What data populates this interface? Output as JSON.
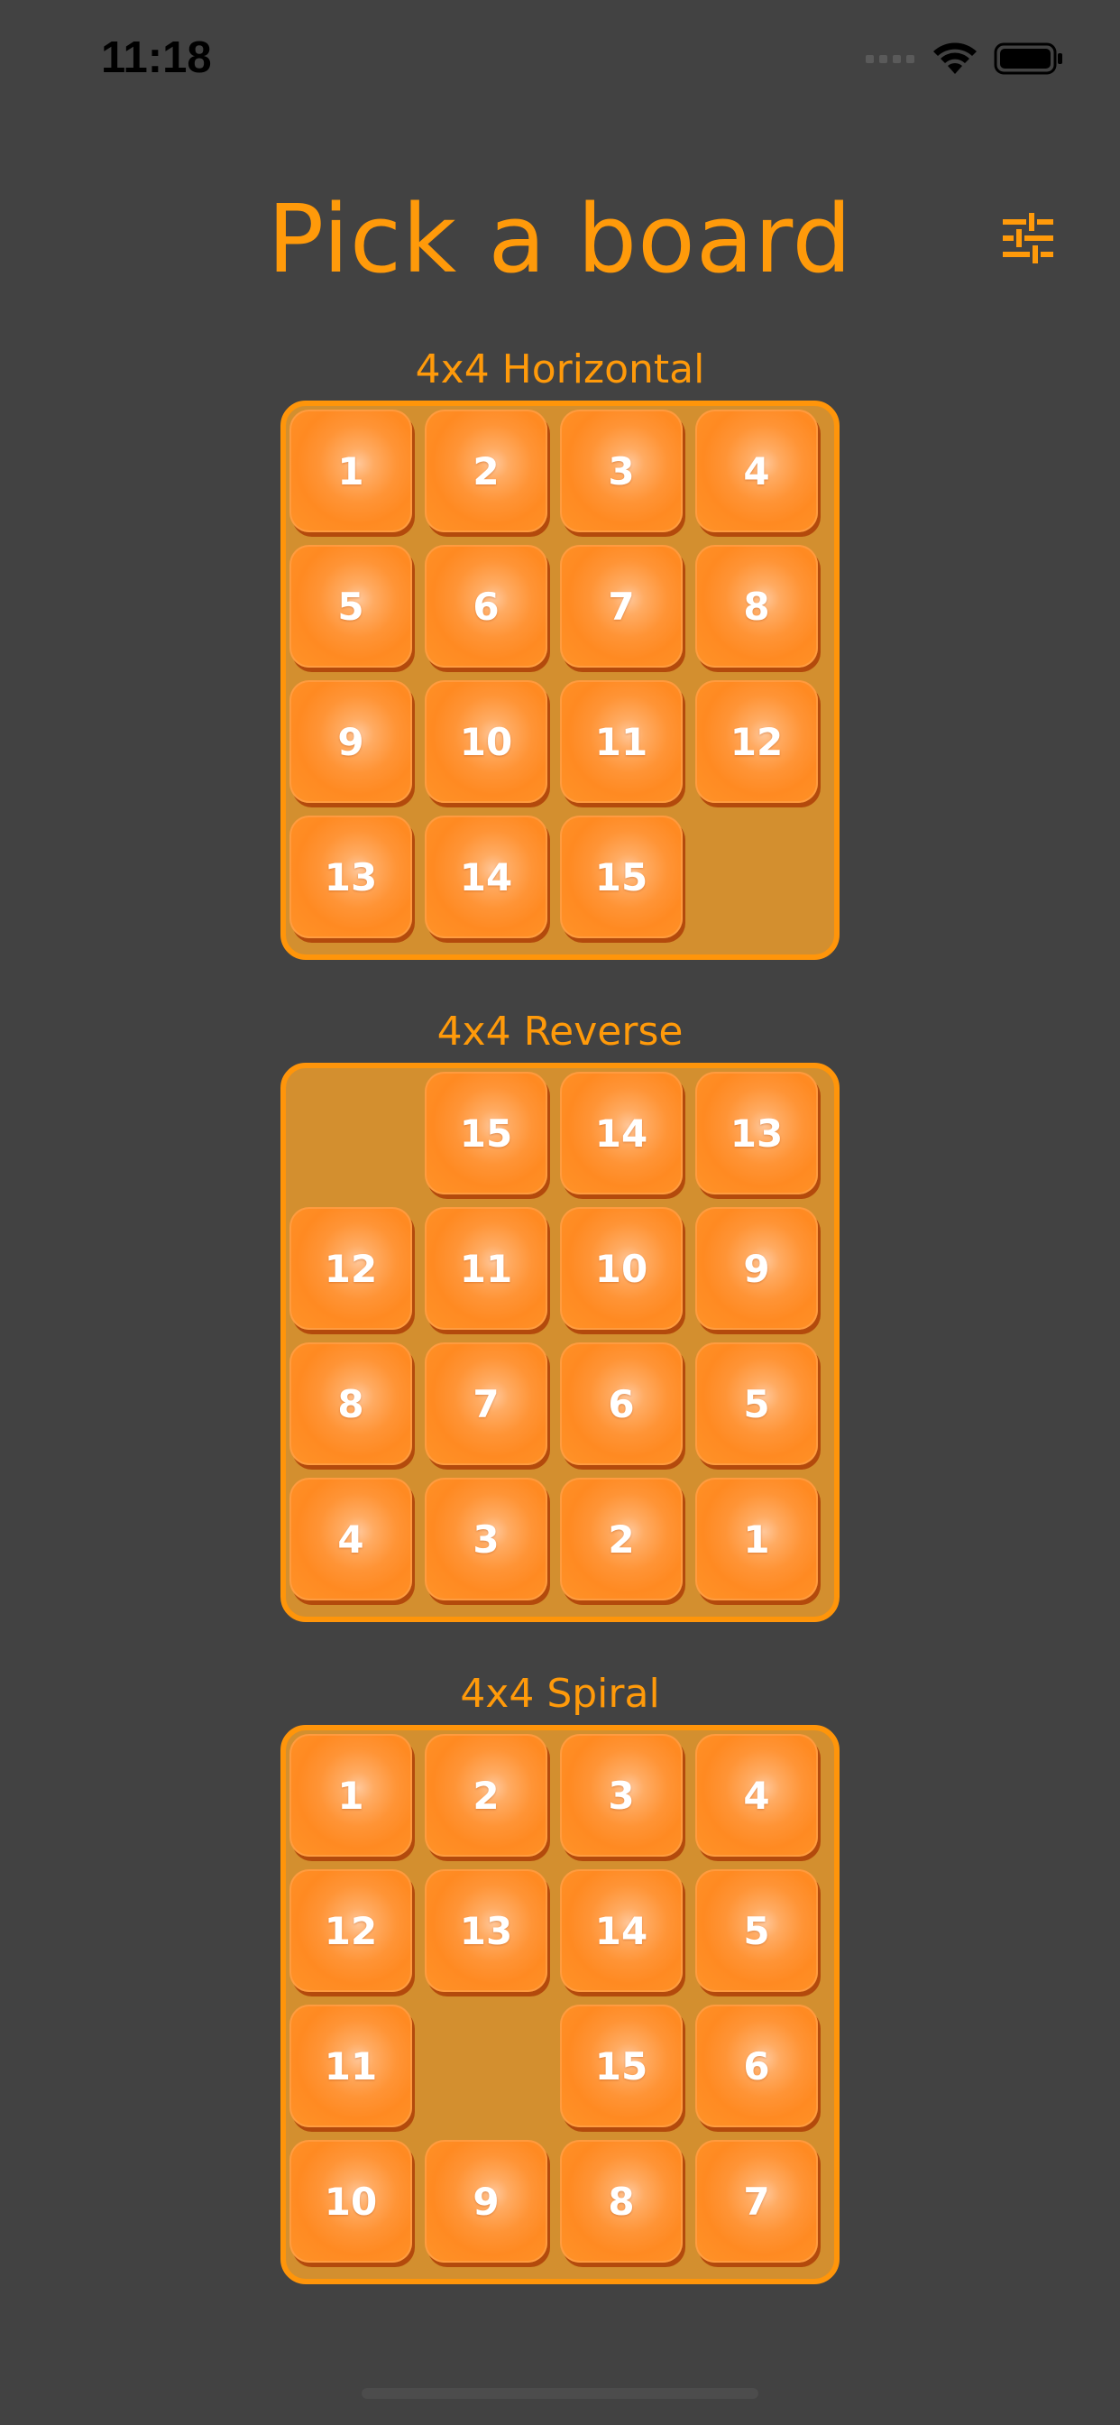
{
  "status_bar": {
    "time": "11:18"
  },
  "header": {
    "title": "Pick a board",
    "settings_icon": "sliders-icon"
  },
  "colors": {
    "background": "#424242",
    "accent": "#ff9a0a",
    "board_fill": "#d38f2f",
    "tile": "#ff9436",
    "tile_text": "#ffffff"
  },
  "boards": [
    {
      "label": "4x4 Horizontal",
      "rows": [
        [
          "1",
          "2",
          "3",
          "4"
        ],
        [
          "5",
          "6",
          "7",
          "8"
        ],
        [
          "9",
          "10",
          "11",
          "12"
        ],
        [
          "13",
          "14",
          "15",
          ""
        ]
      ]
    },
    {
      "label": "4x4 Reverse",
      "rows": [
        [
          "",
          "15",
          "14",
          "13"
        ],
        [
          "12",
          "11",
          "10",
          "9"
        ],
        [
          "8",
          "7",
          "6",
          "5"
        ],
        [
          "4",
          "3",
          "2",
          "1"
        ]
      ]
    },
    {
      "label": "4x4 Spiral",
      "rows": [
        [
          "1",
          "2",
          "3",
          "4"
        ],
        [
          "12",
          "13",
          "14",
          "5"
        ],
        [
          "11",
          "",
          "15",
          "6"
        ],
        [
          "10",
          "9",
          "8",
          "7"
        ]
      ]
    }
  ]
}
